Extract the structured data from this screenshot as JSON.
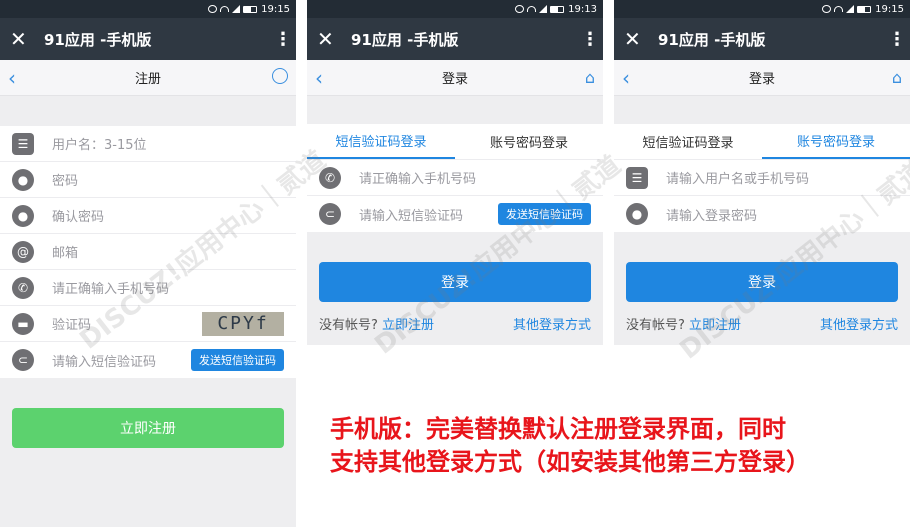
{
  "status": {
    "time_1": "19:15",
    "time_2": "19:13",
    "time_3": "19:15"
  },
  "appbar": {
    "title": "91应用 -手机版",
    "close_glyph": "✕",
    "more_glyph": "⋮"
  },
  "register": {
    "nav_title": "注册",
    "fields": {
      "username": "用户名：3-15位",
      "password": "密码",
      "confirm": "确认密码",
      "email": "邮箱",
      "phone": "请正确输入手机号码",
      "captcha": "验证码",
      "sms": "请输入短信验证码"
    },
    "captcha_text": "CPYf",
    "sms_button": "发送短信验证码",
    "submit": "立即注册"
  },
  "login_sms": {
    "nav_title": "登录",
    "tab_sms": "短信验证码登录",
    "tab_account": "账号密码登录",
    "phone": "请正确输入手机号码",
    "sms": "请输入短信验证码",
    "sms_button": "发送短信验证码",
    "submit": "登录",
    "no_account": "没有帐号?",
    "register_link": "立即注册",
    "other_login": "其他登录方式"
  },
  "login_account": {
    "nav_title": "登录",
    "tab_sms": "短信验证码登录",
    "tab_account": "账号密码登录",
    "username": "请输入用户名或手机号码",
    "password": "请输入登录密码",
    "submit": "登录",
    "no_account": "没有帐号?",
    "register_link": "立即注册",
    "other_login": "其他登录方式"
  },
  "caption": {
    "line1": "手机版：完美替换默认注册登录界面，同时",
    "line2": "支持其他登录方式（如安装其他第三方登录）"
  },
  "watermark": {
    "text": "DISCUZ!应用中心｜贰道"
  },
  "colors": {
    "accent": "#1f86e0",
    "register_green": "#5cd26e",
    "caption_red": "#e8151b",
    "appbar": "#2f3842"
  }
}
